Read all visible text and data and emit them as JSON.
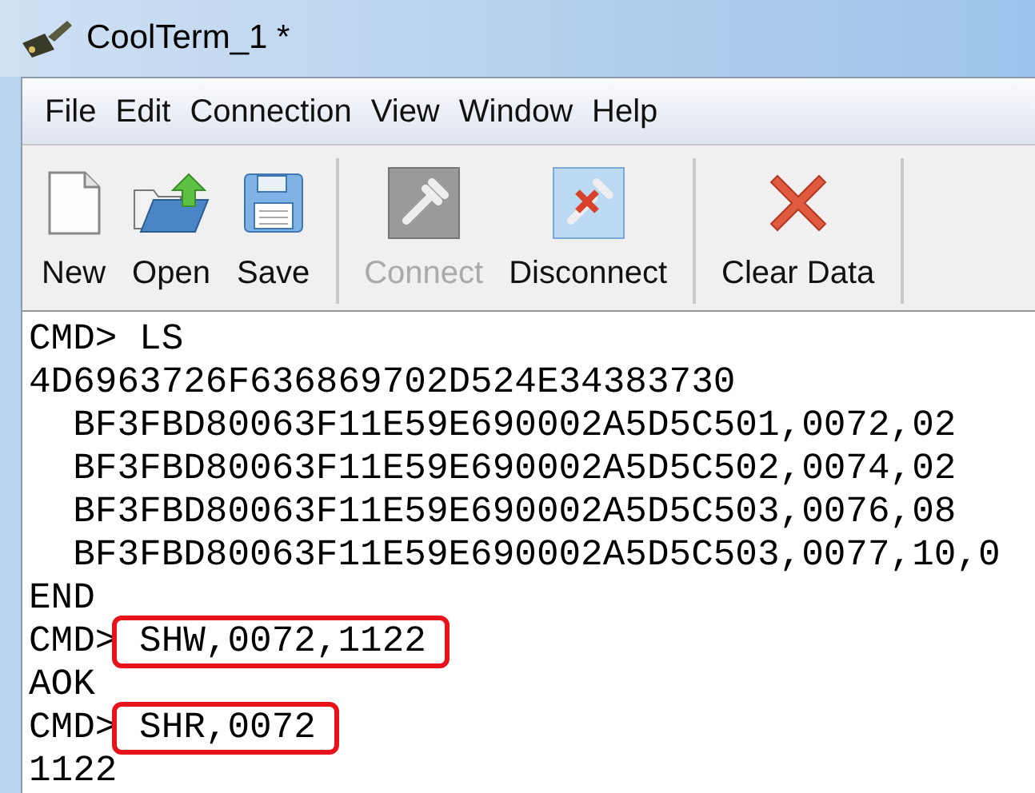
{
  "window": {
    "title": "CoolTerm_1 *"
  },
  "menu": [
    "File",
    "Edit",
    "Connection",
    "View",
    "Window",
    "Help"
  ],
  "toolbar": [
    [
      {
        "label": "New",
        "kind": "new",
        "disabled": false
      },
      {
        "label": "Open",
        "kind": "open",
        "disabled": false
      },
      {
        "label": "Save",
        "kind": "save",
        "disabled": false
      }
    ],
    [
      {
        "label": "Connect",
        "kind": "connect",
        "disabled": true
      },
      {
        "label": "Disconnect",
        "kind": "disconnect",
        "disabled": false
      }
    ],
    [
      {
        "label": "Clear Data",
        "kind": "clear",
        "disabled": false
      }
    ]
  ],
  "terminal": {
    "lines": [
      {
        "prompt": "CMD>",
        "text": " LS",
        "highlighted": false
      },
      {
        "text": "4D6963726F636869702D524E34383730",
        "highlighted": false
      },
      {
        "text": "  BF3FBD80063F11E59E690002A5D5C501,0072,02",
        "highlighted": false
      },
      {
        "text": "  BF3FBD80063F11E59E690002A5D5C502,0074,02",
        "highlighted": false
      },
      {
        "text": "  BF3FBD80063F11E59E690002A5D5C503,0076,08",
        "highlighted": false
      },
      {
        "text": "  BF3FBD80063F11E59E690002A5D5C503,0077,10,0",
        "highlighted": false
      },
      {
        "text": "END",
        "highlighted": false
      },
      {
        "prompt": "CMD>",
        "text": " SHW,0072,1122",
        "highlighted": true
      },
      {
        "text": "AOK",
        "highlighted": false
      },
      {
        "prompt": "CMD>",
        "text": " SHR,0072",
        "highlighted": true
      },
      {
        "text": "1122",
        "highlighted": false
      }
    ]
  }
}
